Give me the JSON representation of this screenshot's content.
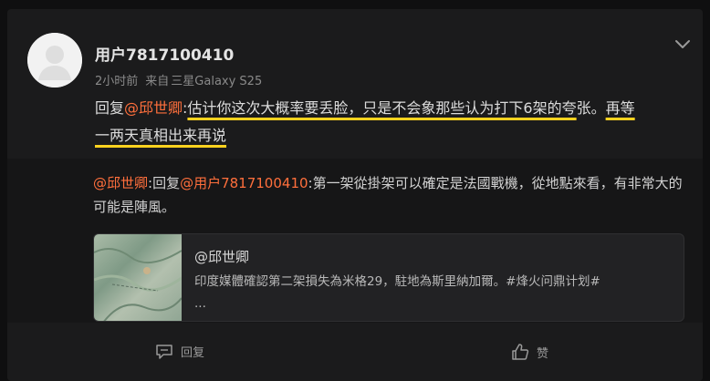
{
  "post": {
    "username": "用户7817100410",
    "time": "2小时前",
    "source_prefix": "来自",
    "device": "三星Galaxy S25",
    "reply_prefix": "回复",
    "reply_mention": "@邱世卿",
    "reply_colon": ":",
    "reply_underlined_1": "估计你这次大概率要丢脸，只是不会象那些认为打下6架的夸",
    "reply_continuation": "张。",
    "reply_underlined_2": "再等一两天真相出来再说"
  },
  "subreply": {
    "mention_1": "@邱世卿",
    "colon_1": ":",
    "reply_word": "回复",
    "mention_2": "@用户7817100410",
    "text": ":第一架從掛架可以確定是法國戰機，從地點來看，有非常大的可能是陣風。"
  },
  "quote": {
    "title": "@邱世卿",
    "body": "印度媒體確認第二架損失為米格29，駐地為斯里納加爾。#烽火问鼎计划#",
    "ellipsis": "..."
  },
  "footer": {
    "reply_label": "回复",
    "like_label": "赞"
  },
  "icons": {
    "collapse": "chevron-down-icon",
    "reply": "comment-icon",
    "like": "thumbs-up-icon"
  },
  "colors": {
    "mention": "#ff6f3c",
    "highlight_underline": "#ffd21f"
  }
}
